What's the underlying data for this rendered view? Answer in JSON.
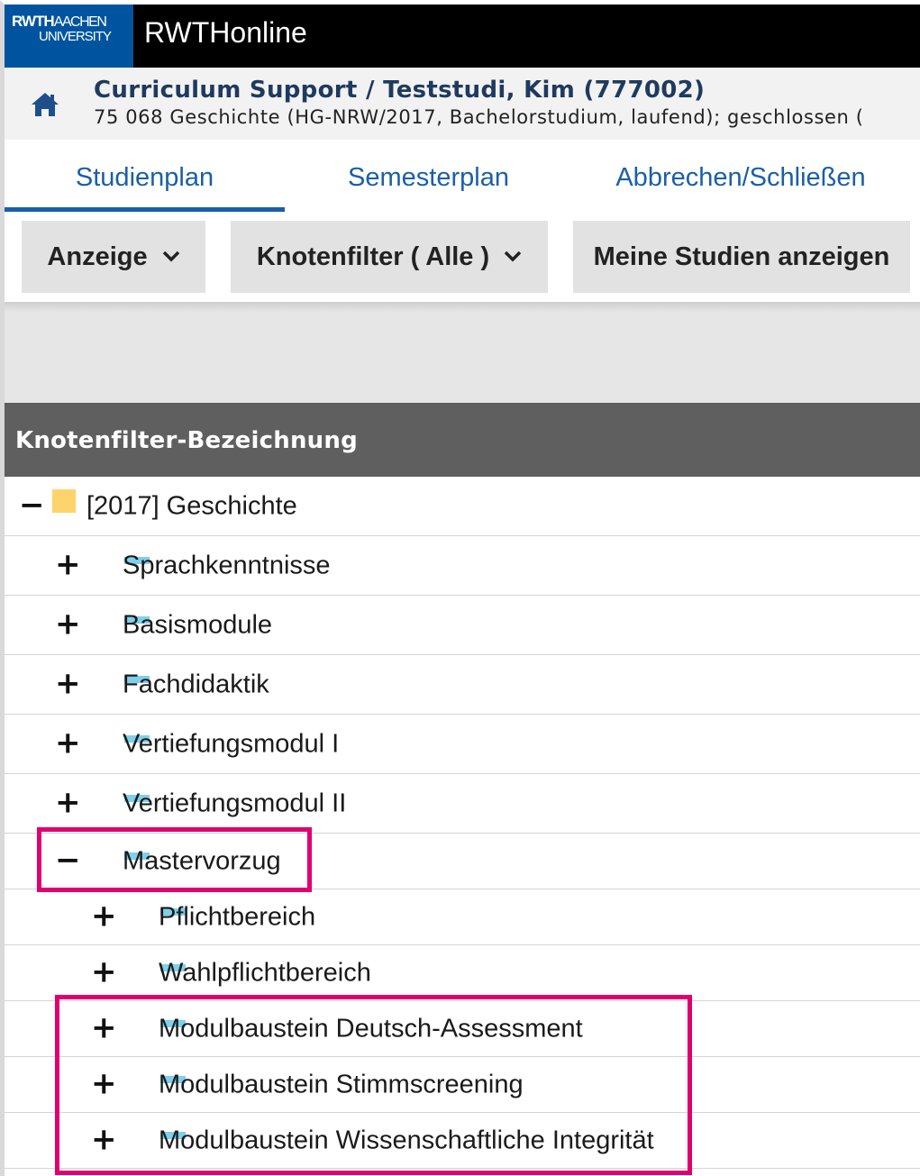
{
  "app": {
    "logo_line1_bold": "RWTH",
    "logo_line1_thin": "AACHEN",
    "logo_line2": "UNIVERSITY",
    "title": "RWTHonline"
  },
  "context": {
    "title": "Curriculum Support  / Teststudi, Kim (777002)",
    "subtitle": "75 068 Geschichte (HG-NRW/2017, Bachelorstudium, laufend); geschlossen (",
    "home_icon": "home-icon"
  },
  "tabs": [
    {
      "label": "Studienplan",
      "active": true
    },
    {
      "label": "Semesterplan",
      "active": false
    },
    {
      "label": "Abbrechen/Schließen",
      "active": false
    }
  ],
  "toolbar": {
    "anzeige": "Anzeige",
    "knotenfilter": "Knotenfilter ( Alle )",
    "meine_studien": "Meine Studien anzeigen"
  },
  "table": {
    "header": "Knotenfilter-Bezeichnung",
    "rows": [
      {
        "label": "[2017] Geschichte",
        "toggle": "−",
        "icon": "folder-icon"
      },
      {
        "label": "Sprachkenntnisse",
        "toggle": "+",
        "icon": "module-group-icon"
      },
      {
        "label": "Basismodule",
        "toggle": "+",
        "icon": "module-group-icon"
      },
      {
        "label": "Fachdidaktik",
        "toggle": "+",
        "icon": "module-group-icon"
      },
      {
        "label": "Vertiefungsmodul I",
        "toggle": "+",
        "icon": "module-group-icon"
      },
      {
        "label": "Vertiefungsmodul II",
        "toggle": "+",
        "icon": "module-group-icon"
      },
      {
        "label": "Mastervorzug",
        "toggle": "−",
        "icon": "module-group-icon"
      },
      {
        "label": "Pflichtbereich",
        "toggle": "+",
        "icon": "module-group-icon"
      },
      {
        "label": "Wahlpflichtbereich",
        "toggle": "+",
        "icon": "module-group-icon"
      },
      {
        "label": "Modulbaustein Deutsch-Assessment",
        "toggle": "+",
        "icon": "module-group-icon"
      },
      {
        "label": "Modulbaustein Stimmscreening",
        "toggle": "+",
        "icon": "module-group-icon"
      },
      {
        "label": "Modulbaustein Wissenschaftliche Integrität",
        "toggle": "+",
        "icon": "module-group-icon"
      }
    ]
  },
  "colors": {
    "brand_blue": "#00549f",
    "link_blue": "#1a5fa8",
    "highlight": "#e0006e",
    "folder": "#fdd36b",
    "node": "#7fd0ea"
  }
}
